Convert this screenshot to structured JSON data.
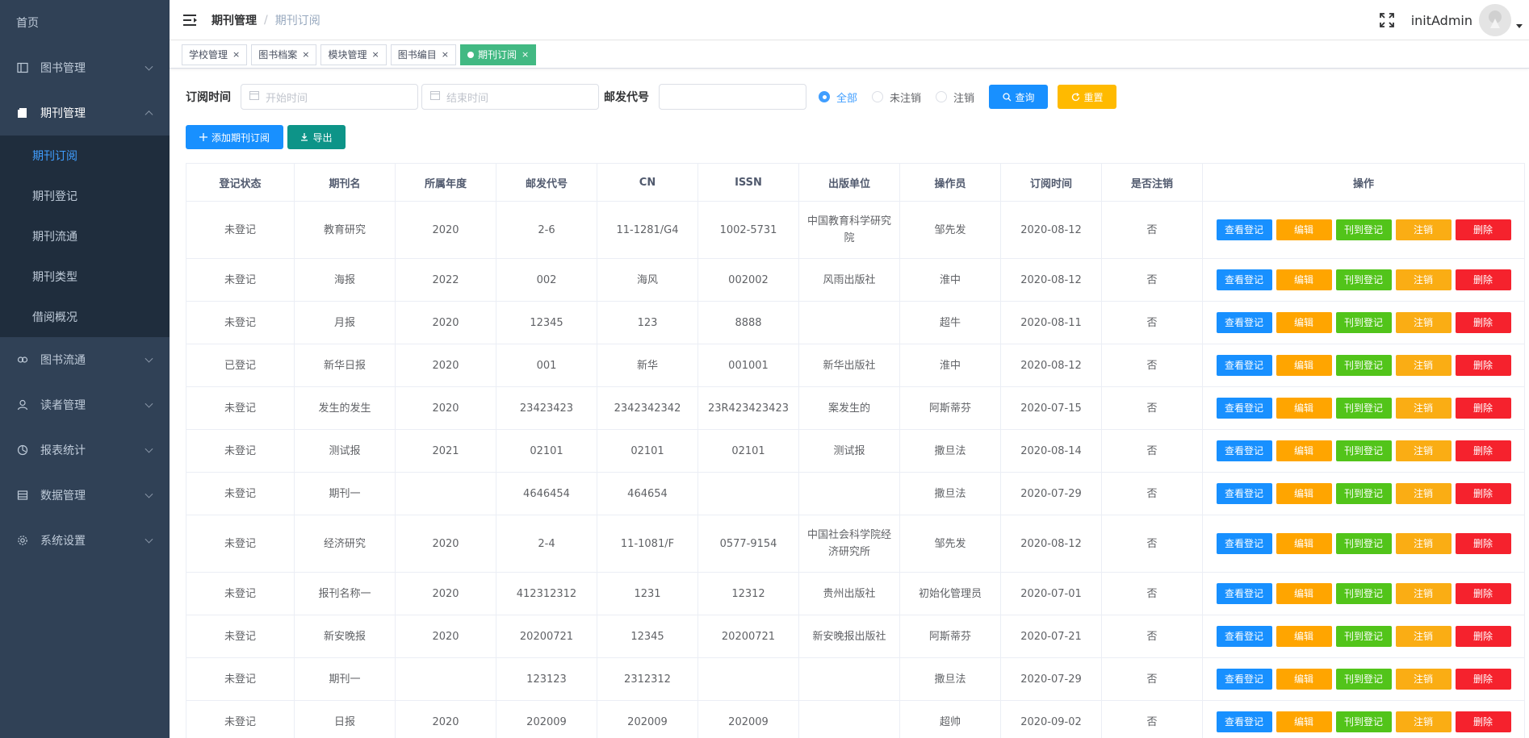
{
  "sidebar": {
    "home": "首页",
    "items": [
      {
        "label": "图书管理",
        "icon": "book-icon"
      },
      {
        "label": "期刊管理",
        "icon": "journal-icon"
      },
      {
        "label": "图书流通",
        "icon": "link-icon"
      },
      {
        "label": "读者管理",
        "icon": "user-icon"
      },
      {
        "label": "报表统计",
        "icon": "chart-icon"
      },
      {
        "label": "数据管理",
        "icon": "database-icon"
      },
      {
        "label": "系统设置",
        "icon": "gear-icon"
      }
    ],
    "submenu": [
      "期刊订阅",
      "期刊登记",
      "期刊流通",
      "期刊类型",
      "借阅概况"
    ]
  },
  "header": {
    "breadcrumb_parent": "期刊管理",
    "breadcrumb_separator": "/",
    "breadcrumb_current": "期刊订阅",
    "username": "initAdmin"
  },
  "tags": [
    "学校管理",
    "图书档案",
    "模块管理",
    "图书编目",
    "期刊订阅"
  ],
  "tag_close": "×",
  "filter": {
    "time_label": "订阅时间",
    "start_placeholder": "开始时间",
    "end_placeholder": "结束时间",
    "code_label": "邮发代号",
    "radio_all": "全部",
    "radio_not_cancelled": "未注销",
    "radio_cancelled": "注销",
    "search_button": "查询",
    "reset_button": "重置"
  },
  "actions": {
    "add_button": "添加期刊订阅",
    "export_button": "导出"
  },
  "table": {
    "columns": [
      "登记状态",
      "期刊名",
      "所属年度",
      "邮发代号",
      "CN",
      "ISSN",
      "出版单位",
      "操作员",
      "订阅时间",
      "是否注销",
      "操作"
    ],
    "row_actions": {
      "view": "查看登记",
      "edit": "编辑",
      "register": "刊到登记",
      "cancel": "注销",
      "delete": "删除"
    },
    "rows": [
      [
        "未登记",
        "教育研究",
        "2020",
        "2-6",
        "11-1281/G4",
        "1002-5731",
        "中国教育科学研究院",
        "邹先发",
        "2020-08-12",
        "否"
      ],
      [
        "未登记",
        "海报",
        "2022",
        "002",
        "海风",
        "002002",
        "风雨出版社",
        "淮中",
        "2020-08-12",
        "否"
      ],
      [
        "未登记",
        "月报",
        "2020",
        "12345",
        "123",
        "8888",
        "",
        "超牛",
        "2020-08-11",
        "否"
      ],
      [
        "已登记",
        "新华日报",
        "2020",
        "001",
        "新华",
        "001001",
        "新华出版社",
        "淮中",
        "2020-08-12",
        "否"
      ],
      [
        "未登记",
        "发生的发生",
        "2020",
        "23423423",
        "2342342342",
        "23R423423423",
        "案发生的",
        "阿斯蒂芬",
        "2020-07-15",
        "否"
      ],
      [
        "未登记",
        "测试报",
        "2021",
        "02101",
        "02101",
        "02101",
        "测试报",
        "撒旦法",
        "2020-08-14",
        "否"
      ],
      [
        "未登记",
        "期刊一",
        "",
        "4646454",
        "464654",
        "",
        "",
        "撒旦法",
        "2020-07-29",
        "否"
      ],
      [
        "未登记",
        "经济研究",
        "2020",
        "2-4",
        "11-1081/F",
        "0577-9154",
        "中国社会科学院经济研究所",
        "邹先发",
        "2020-08-12",
        "否"
      ],
      [
        "未登记",
        "报刊名称一",
        "2020",
        "412312312",
        "1231",
        "12312",
        "贵州出版社",
        "初始化管理员",
        "2020-07-01",
        "否"
      ],
      [
        "未登记",
        "新安晚报",
        "2020",
        "20200721",
        "12345",
        "20200721",
        "新安晚报出版社",
        "阿斯蒂芬",
        "2020-07-21",
        "否"
      ],
      [
        "未登记",
        "期刊一",
        "",
        "123123",
        "2312312",
        "",
        "",
        "撒旦法",
        "2020-07-29",
        "否"
      ],
      [
        "未登记",
        "日报",
        "2020",
        "202009",
        "202009",
        "202009",
        "",
        "超帅",
        "2020-09-02",
        "否"
      ]
    ]
  },
  "colors": {
    "sidebar_bg": "#304156",
    "submenu_bg": "#1f2d3d",
    "accent": "#409eff",
    "tag_active": "#42b983"
  }
}
